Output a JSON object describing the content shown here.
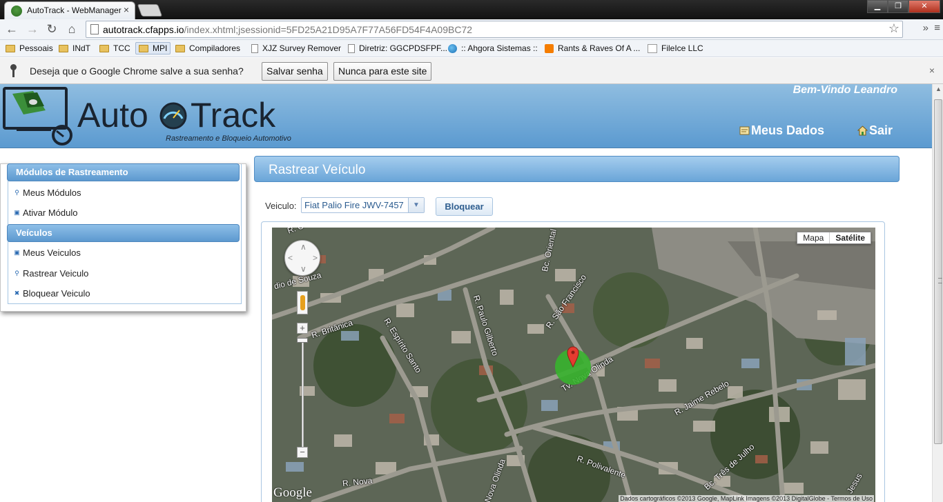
{
  "browser": {
    "tab_title": "AutoTrack - WebManager",
    "tab_close": "×",
    "url_host": "autotrack.cfapps.io",
    "url_path": "/index.xhtml;jsessionid=5FD25A21D95A7F77A56FD54F4A09BC72",
    "bookmarks": [
      {
        "label": "Pessoais",
        "icon": "folder-icon"
      },
      {
        "label": "INdT",
        "icon": "folder-icon"
      },
      {
        "label": "TCC",
        "icon": "folder-icon"
      },
      {
        "label": "MPI",
        "icon": "folder-icon"
      },
      {
        "label": "Compiladores",
        "icon": "folder-icon"
      },
      {
        "label": "XJZ Survey Remover",
        "icon": "page-icon"
      },
      {
        "label": "Diretriz: GGCPDSFPF...",
        "icon": "page-icon"
      },
      {
        "label": ":: Ahgora Sistemas ::",
        "icon": "globe-icon"
      },
      {
        "label": "Rants & Raves Of A ...",
        "icon": "blogger-icon"
      },
      {
        "label": "FileIce LLC",
        "icon": "site-icon"
      }
    ],
    "infobar_message": "Deseja que o Google Chrome salve a sua senha?",
    "infobar_save": "Salvar senha",
    "infobar_never": "Nunca para este site",
    "infobar_close": "×"
  },
  "header": {
    "logo_text_a": "Auto",
    "logo_text_b": "Track",
    "logo_tagline": "Rastreamento e Bloqueio Automotivo",
    "welcome": "Bem-Vindo Leandro",
    "my_data": "Meus Dados",
    "logout": "Sair"
  },
  "sidebar": {
    "section1": "Módulos de Rastreamento",
    "item_my_modules": "Meus Módulos",
    "item_activate_module": "Ativar Módulo",
    "section2": "Veículos",
    "item_my_vehicles": "Meus Veiculos",
    "item_track_vehicle": "Rastrear Veiculo",
    "item_block_vehicle": "Bloquear Veiculo"
  },
  "main": {
    "panel_title": "Rastrear Veículo",
    "vehicle_label": "Veiculo:",
    "vehicle_selected": "Fiat Palio Fire JWV-7457",
    "block_button": "Bloquear"
  },
  "map": {
    "type_map": "Mapa",
    "type_satellite": "Satélite",
    "google": "Google",
    "attribution": "Dados cartográficos ©2013 Google, MapLink Imagens ©2013 DigitalGlobe - Termos de Uso",
    "zoom_in": "+",
    "zoom_out": "−",
    "streets": [
      "R. C",
      "dio de Souza",
      "R. Britânica",
      "R. Espírito Santo",
      "R. Paulo Gilberto",
      "Bc. Oriental",
      "R. São Francisco",
      "Tv. Nova Olinda",
      "R. Jaime Rebelo",
      "R. Polivalente",
      "R. Nova",
      "Nova Olinda",
      "Bc. Três de Julho",
      "Jesus"
    ]
  },
  "colors": {
    "header_blue": "#5b9ad0",
    "panel_blue": "#6aa5d8",
    "marker_red": "#e53b30",
    "marker_circle": "#37b22e"
  }
}
